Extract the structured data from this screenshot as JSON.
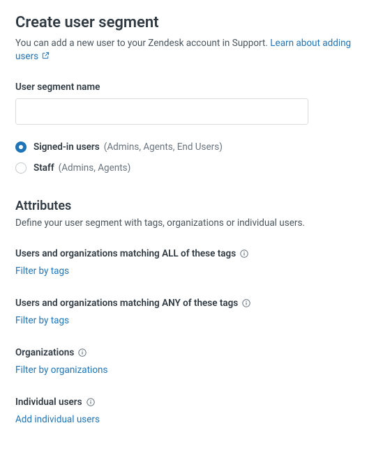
{
  "page": {
    "title": "Create user segment",
    "description": "You can add a new user to your Zendesk account in Support.",
    "learn_link": "Learn about adding users"
  },
  "nameField": {
    "label": "User segment name",
    "value": ""
  },
  "userTypes": {
    "signedIn": {
      "label": "Signed-in users",
      "sublabel": "(Admins, Agents, End Users)"
    },
    "staff": {
      "label": "Staff",
      "sublabel": "(Admins, Agents)"
    }
  },
  "attributes": {
    "title": "Attributes",
    "description": "Define your user segment with tags, organizations or individual users.",
    "allTags": {
      "label": "Users and organizations matching ALL of these tags",
      "action": "Filter by tags"
    },
    "anyTags": {
      "label": "Users and organizations matching ANY of these tags",
      "action": "Filter by tags"
    },
    "organizations": {
      "label": "Organizations",
      "action": "Filter by organizations"
    },
    "individualUsers": {
      "label": "Individual users",
      "action": "Add individual users"
    }
  }
}
